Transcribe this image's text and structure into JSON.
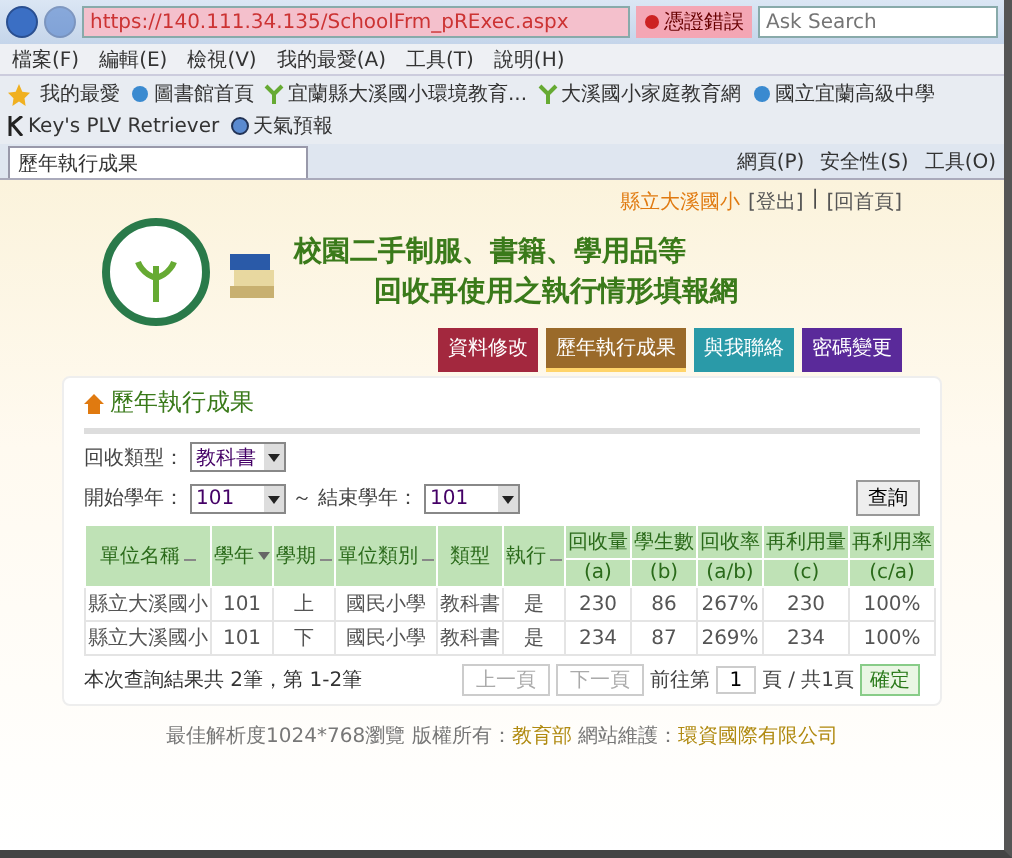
{
  "address_bar": {
    "url": "https://140.111.34.135/SchoolFrm_pRExec.aspx",
    "cert_error": "憑證錯誤",
    "search_placeholder": "Ask Search"
  },
  "menu": [
    "檔案(F)",
    "編輯(E)",
    "檢視(V)",
    "我的最愛(A)",
    "工具(T)",
    "說明(H)"
  ],
  "favorites_label": "我的最愛",
  "favorites": [
    {
      "kind": "ie",
      "label": "圖書館首頁"
    },
    {
      "kind": "leaf",
      "label": "宜蘭縣大溪國小環境教育..."
    },
    {
      "kind": "leaf",
      "label": "大溪國小家庭教育網"
    },
    {
      "kind": "ie",
      "label": "國立宜蘭高級中學"
    },
    {
      "kind": "letter",
      "label": "Key's PLV Retriever"
    },
    {
      "kind": "globe",
      "label": "天氣預報"
    }
  ],
  "tabs": [
    {
      "title": "歷年執行成果",
      "selected": true
    }
  ],
  "command_bar": [
    "網頁(P)",
    "安全性(S)",
    "工具(O)"
  ],
  "user": {
    "school": "縣立大溪國小",
    "logout": "[登出]",
    "separator": "|",
    "home": "[回首頁]"
  },
  "site_title": [
    "校園二手制服、書籍、學用品等",
    "回收再使用之執行情形填報網"
  ],
  "nav": [
    {
      "label": "資料修改",
      "color": "#a3283e",
      "selected": false
    },
    {
      "label": "歷年執行成果",
      "color": "#9a6a2a",
      "selected": true
    },
    {
      "label": "與我聯絡",
      "color": "#2a9aa8",
      "selected": false
    },
    {
      "label": "密碼變更",
      "color": "#5a2a9a",
      "selected": false
    }
  ],
  "breadcrumb": "歷年執行成果",
  "form": {
    "type_label": "回收類型：",
    "type_value": "教科書",
    "start_label": "開始學年：",
    "start_value": "101",
    "range_sep": "～",
    "end_label": "結束學年：",
    "end_value": "101",
    "query_button": "查詢"
  },
  "table": {
    "columns": [
      {
        "label": "單位名稱",
        "sorted": false
      },
      {
        "label": "學年",
        "sorted": true
      },
      {
        "label": "學期",
        "sorted": false
      },
      {
        "label": "單位類別",
        "sorted": false
      },
      {
        "label": "類型"
      },
      {
        "label": "執行",
        "sorted": false
      },
      {
        "label": "回收量",
        "sub": "(a)"
      },
      {
        "label": "學生數",
        "sub": "(b)"
      },
      {
        "label": "回收率",
        "sub": "(a/b)"
      },
      {
        "label": "再利用量",
        "sub": "(c)"
      },
      {
        "label": "再利用率",
        "sub": "(c/a)"
      }
    ],
    "rows": [
      [
        "縣立大溪國小",
        "101",
        "上",
        "國民小學",
        "教科書",
        "是",
        "230",
        "86",
        "267%",
        "230",
        "100%"
      ],
      [
        "縣立大溪國小",
        "101",
        "下",
        "國民小學",
        "教科書",
        "是",
        "234",
        "87",
        "269%",
        "234",
        "100%"
      ]
    ]
  },
  "summary": "本次查詢結果共 2筆，第 1-2筆",
  "pager": {
    "prev": "上一頁",
    "next": "下一頁",
    "goto_label": "前往第",
    "page_value": "1",
    "page_suffix": "頁 / 共1頁",
    "confirm": "確定",
    "prev_disabled": true,
    "next_disabled": true
  },
  "footer": {
    "text": "最佳解析度1024*768瀏覽 版權所有：",
    "owner": "教育部",
    "maint_label": " 網站維護：",
    "maintainer": "環資國際有限公司"
  }
}
